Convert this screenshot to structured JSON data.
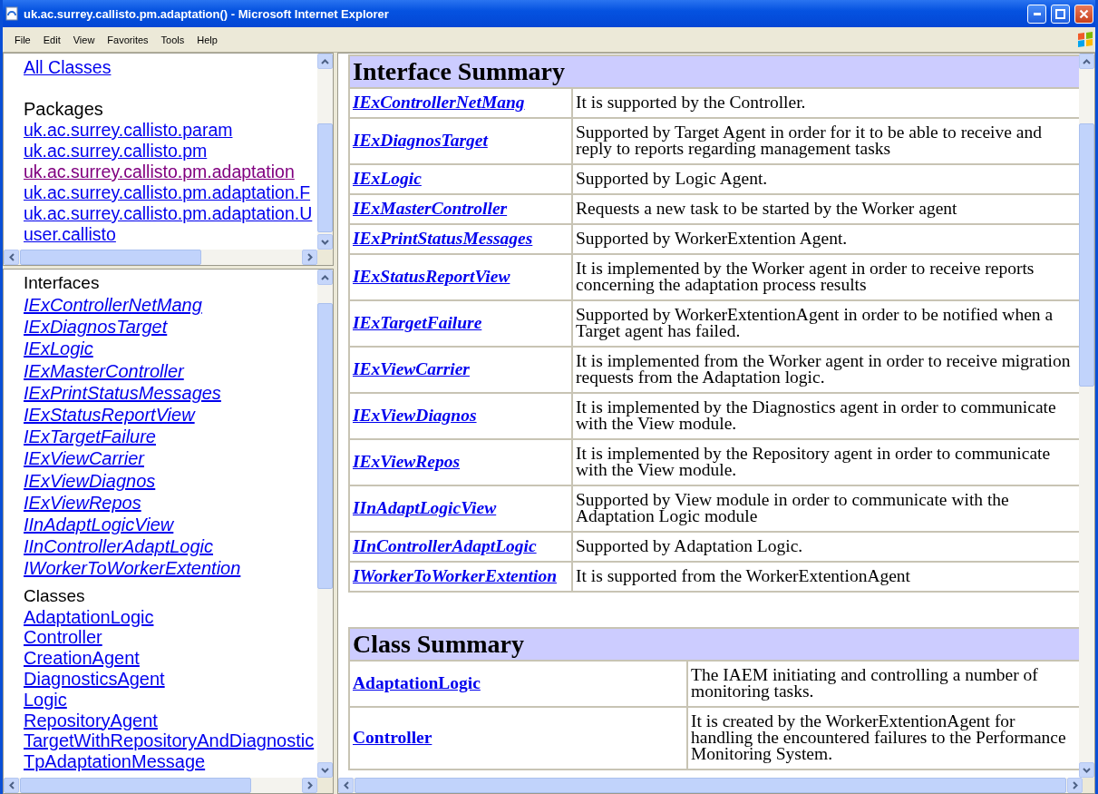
{
  "window": {
    "title": "uk.ac.surrey.callisto.pm.adaptation() - Microsoft Internet Explorer"
  },
  "menu": [
    "File",
    "Edit",
    "View",
    "Favorites",
    "Tools",
    "Help"
  ],
  "packages_frame": {
    "all_classes": "All Classes",
    "heading": "Packages",
    "packages": [
      {
        "name": "uk.ac.surrey.callisto.param",
        "visited": false
      },
      {
        "name": "uk.ac.surrey.callisto.pm",
        "visited": false
      },
      {
        "name": "uk.ac.surrey.callisto.pm.adaptation",
        "visited": true
      },
      {
        "name": "uk.ac.surrey.callisto.pm.adaptation.F",
        "visited": false
      },
      {
        "name": "uk.ac.surrey.callisto.pm.adaptation.U",
        "visited": false
      },
      {
        "name": "user.callisto",
        "visited": false
      }
    ]
  },
  "classes_frame": {
    "interfaces_heading": "Interfaces",
    "interfaces": [
      "IExControllerNetMang",
      "IExDiagnosTarget",
      "IExLogic",
      "IExMasterController",
      "IExPrintStatusMessages",
      "IExStatusReportView",
      "IExTargetFailure",
      "IExViewCarrier",
      "IExViewDiagnos",
      "IExViewRepos",
      "IInAdaptLogicView",
      "IInControllerAdaptLogic",
      "IWorkerToWorkerExtention"
    ],
    "classes_heading": "Classes",
    "classes": [
      "AdaptationLogic",
      "Controller",
      "CreationAgent",
      "DiagnosticsAgent",
      "Logic",
      "RepositoryAgent",
      "TargetWithRepositoryAndDiagnostic",
      "TpAdaptationMessage"
    ]
  },
  "interface_summary": {
    "title": "Interface Summary",
    "rows": [
      {
        "name": "IExControllerNetMang",
        "description": "It is supported by the Controller."
      },
      {
        "name": "IExDiagnosTarget",
        "description": "Supported by Target Agent in order for it to be able to receive and reply to reports regarding management tasks"
      },
      {
        "name": "IExLogic",
        "description": "Supported by Logic Agent."
      },
      {
        "name": "IExMasterController",
        "description": "Requests a new task to be started by the Worker agent"
      },
      {
        "name": "IExPrintStatusMessages",
        "description": "Supported by WorkerExtention Agent."
      },
      {
        "name": "IExStatusReportView",
        "description": "It is implemented by the Worker agent in order to receive reports concerning the adaptation process results"
      },
      {
        "name": "IExTargetFailure",
        "description": "Supported by WorkerExtentionAgent in order to be notified when a Target agent has failed."
      },
      {
        "name": "IExViewCarrier",
        "description": "It is implemented from the Worker agent in order to receive migration requests from the Adaptation logic."
      },
      {
        "name": "IExViewDiagnos",
        "description": "It is implemented by the Diagnostics agent in order to communicate with the View module."
      },
      {
        "name": "IExViewRepos",
        "description": "It is implemented by the Repository agent in order to communicate with the View module."
      },
      {
        "name": "IInAdaptLogicView",
        "description": "Supported by View module in order to communicate with the Adaptation Logic module"
      },
      {
        "name": "IInControllerAdaptLogic",
        "description": "Supported by Adaptation Logic."
      },
      {
        "name": "IWorkerToWorkerExtention",
        "description": "It is supported from the WorkerExtentionAgent"
      }
    ]
  },
  "class_summary": {
    "title": "Class Summary",
    "rows": [
      {
        "name": "AdaptationLogic",
        "description": "The IAEM initiating and controlling a number of monitoring tasks."
      },
      {
        "name": "Controller",
        "description": "It is created by the WorkerExtentionAgent for handling the encountered failures to the Performance Monitoring System."
      }
    ]
  }
}
